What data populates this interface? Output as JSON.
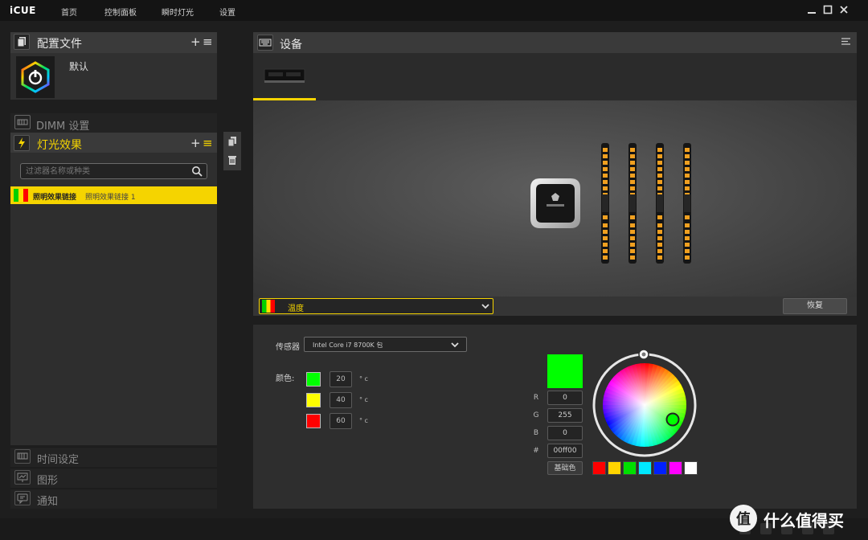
{
  "app": {
    "title": "iCUE",
    "nav": [
      "首页",
      "控制面板",
      "瞬时灯光",
      "设置"
    ]
  },
  "profiles": {
    "title": "配置文件",
    "add": "+",
    "menu": "≡",
    "default_profile": "默认"
  },
  "dimm_settings": {
    "label": "DIMM 设置"
  },
  "lighting": {
    "title": "灯光效果",
    "add": "+",
    "menu": "≡",
    "filter_placeholder": "过滤器名称或种类",
    "effect_name": "照明效果链接",
    "effect_detail": "照明效果链接 1"
  },
  "bottom_sections": [
    {
      "label": "时间设定",
      "icon": "timer-icon"
    },
    {
      "label": "图形",
      "icon": "graph-icon"
    },
    {
      "label": "通知",
      "icon": "notification-icon"
    }
  ],
  "devices": {
    "title": "设备"
  },
  "effect_bar": {
    "effect_label": "温度",
    "restore_label": "恢复"
  },
  "sensor": {
    "label": "传感器",
    "value": "Intel Core i7 8700K 包"
  },
  "colors": {
    "label": "颜色:",
    "stops": [
      {
        "temp": "20",
        "unit": "° c",
        "color": "#00ff00"
      },
      {
        "temp": "40",
        "unit": "° c",
        "color": "#ffff00"
      },
      {
        "temp": "60",
        "unit": "° c",
        "color": "#ff0000"
      }
    ]
  },
  "picker": {
    "current_color": "#00ff00",
    "r_label": "R",
    "g_label": "G",
    "b_label": "B",
    "hex_label": "#",
    "r": "0",
    "g": "255",
    "b": "0",
    "hex": "00ff00",
    "base_color_label": "基础色",
    "presets": [
      "#ff0000",
      "#ffd400",
      "#00e000",
      "#00e8ff",
      "#0020ff",
      "#ff00ff",
      "#ffffff"
    ]
  },
  "accent": "#f5d400",
  "watermark": "什么值得买"
}
